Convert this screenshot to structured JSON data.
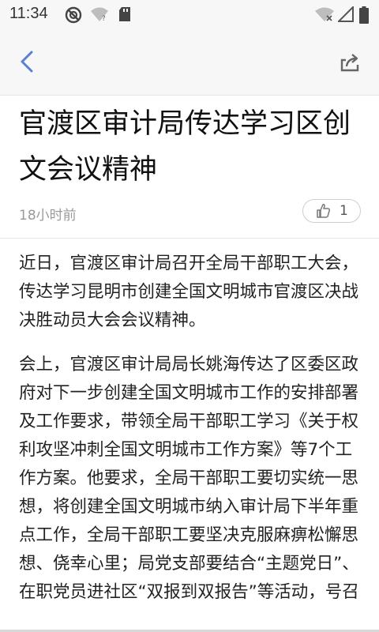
{
  "status_bar": {
    "time": "11:34",
    "left_icons": [
      "do-not-disturb-icon",
      "wifi-question-icon",
      "sd-card-icon"
    ],
    "right_icons": [
      "wifi-off-icon",
      "cellular-signal-icon",
      "battery-icon"
    ]
  },
  "app_bar": {
    "back_icon": "chevron-left-icon",
    "share_icon": "share-icon"
  },
  "article": {
    "title": "官渡区审计局传达学习区创文会议精神",
    "time_ago": "18小时前",
    "like_count": "1",
    "paragraphs": [
      "近日，官渡区审计局召开全局干部职工大会，传达学习昆明市创建全国文明城市官渡区决战决胜动员大会会议精神。",
      "会上，官渡区审计局局长姚海传达了区委区政府对下一步创建全国文明城市工作的安排部署及工作要求，带领全局干部职工学习《关于权利攻坚冲刺全国文明城市工作方案》等7个工作方案。他要求，全局干部职工要切实统一思想，将创建全国文明城市纳入审计局下半年重点工作，全局干部职工要坚决克服麻痹松懈思想、侥幸心里；局党支部要结合“主题党日”、在职党员进社区“双报到双报告”等活动，号召"
    ]
  },
  "colors": {
    "accent_blue": "#5b7fd4",
    "bar_bg": "#f7f7f7",
    "meta_gray": "#9a9a9a"
  }
}
